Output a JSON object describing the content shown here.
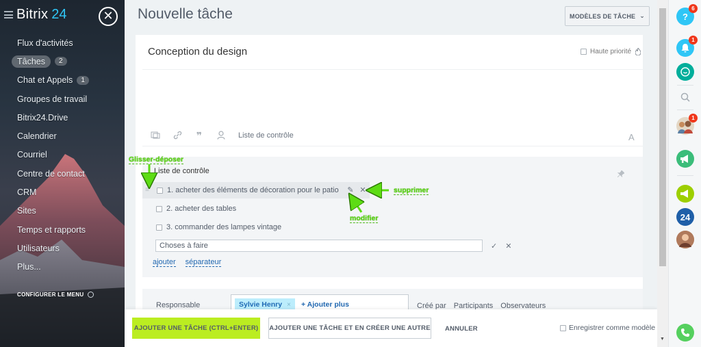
{
  "sidebar": {
    "logo": "Bitrix",
    "logo_suffix": "24",
    "close_glyph": "✕",
    "items": [
      {
        "label": "Flux d'activités"
      },
      {
        "label": "Tâches",
        "badge": "2",
        "active": true
      },
      {
        "label": "Chat et Appels",
        "badge": "1"
      },
      {
        "label": "Groupes de travail"
      },
      {
        "label": "Bitrix24.Drive"
      },
      {
        "label": "Calendrier"
      },
      {
        "label": "Courriel"
      },
      {
        "label": "Centre de contact"
      },
      {
        "label": "CRM"
      },
      {
        "label": "Sites"
      },
      {
        "label": "Temps et rapports"
      },
      {
        "label": "Utilisateurs"
      },
      {
        "label": "Plus..."
      }
    ],
    "config_menu": "CONFIGURER LE MENU"
  },
  "header": {
    "title": "Nouvelle tâche",
    "templates_button": "MODÈLES DE TÂCHE",
    "templates_chevron": "⌄"
  },
  "task": {
    "title": "Conception du design",
    "priority_label": "Haute priorité",
    "toolbar_checklist_label": "Liste de contrôle",
    "font_button": "A"
  },
  "checklist": {
    "title": "Liste de contrôle",
    "items": [
      {
        "label": "1. acheter des éléments de décoration pour le patio"
      },
      {
        "label": "2. acheter des tables"
      },
      {
        "label": "3. commander des lampes vintage"
      }
    ],
    "new_item_value": "Choses à faire",
    "ok_glyph": "✓",
    "cancel_glyph": "✕",
    "edit_glyph": "✎",
    "delete_glyph": "✕",
    "drag_glyph": "≡",
    "link_add": "ajouter",
    "link_separator": "séparateur"
  },
  "responsible": {
    "label": "Responsable",
    "person": "Sylvie Henry",
    "remove_glyph": "×",
    "add_more": "+ Ajouter plus",
    "roles": [
      "Créé par",
      "Participants",
      "Observateurs"
    ]
  },
  "footer": {
    "add_task": "AJOUTER UNE TÂCHE (CTRL+ENTER)",
    "add_and_create": "AJOUTER UNE TÂCHE ET EN CRÉER UNE AUTRE",
    "cancel": "ANNULER",
    "save_as_template": "Enregistrer comme modèle"
  },
  "rightbar": {
    "help_glyph": "?",
    "help_badge": "6",
    "notif_badge": "1",
    "contacts_badge": "1",
    "logo_24": "24"
  },
  "annotations": {
    "drag_drop": "Glisser-déposer",
    "delete": "supprimer",
    "edit": "modifier"
  },
  "colors": {
    "accent_green": "#bbed21",
    "link_blue": "#2067b0",
    "annotation_green": "#5ddc14",
    "badge_red": "#f0371b"
  }
}
